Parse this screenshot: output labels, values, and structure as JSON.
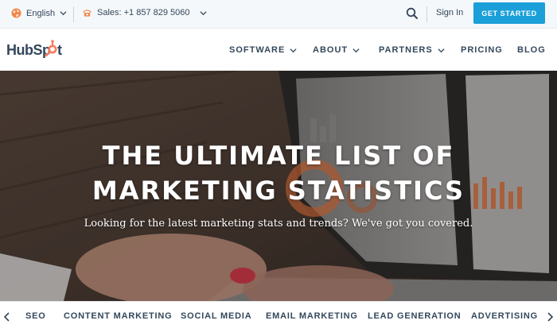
{
  "utility_bar": {
    "language": "English",
    "sales": "Sales: +1 857 829 5060",
    "sign_in": "Sign In",
    "cta": "GET STARTED"
  },
  "nav": {
    "logo_text": "HubSpot",
    "items": [
      "SOFTWARE",
      "ABOUT",
      "PARTNERS",
      "PRICING",
      "BLOG"
    ]
  },
  "hero": {
    "title_line1": "THE ULTIMATE LIST OF",
    "title_line2": "MARKETING STATISTICS",
    "subtitle": "Looking for the latest marketing stats and trends? We've got you covered."
  },
  "topics": [
    "SEO",
    "CONTENT MARKETING",
    "SOCIAL MEDIA",
    "EMAIL MARKETING",
    "LEAD GENERATION",
    "ADVERTISING"
  ],
  "colors": {
    "accent": "#1a9fd9",
    "brand_orange": "#ff7a59",
    "text": "#33475b"
  }
}
